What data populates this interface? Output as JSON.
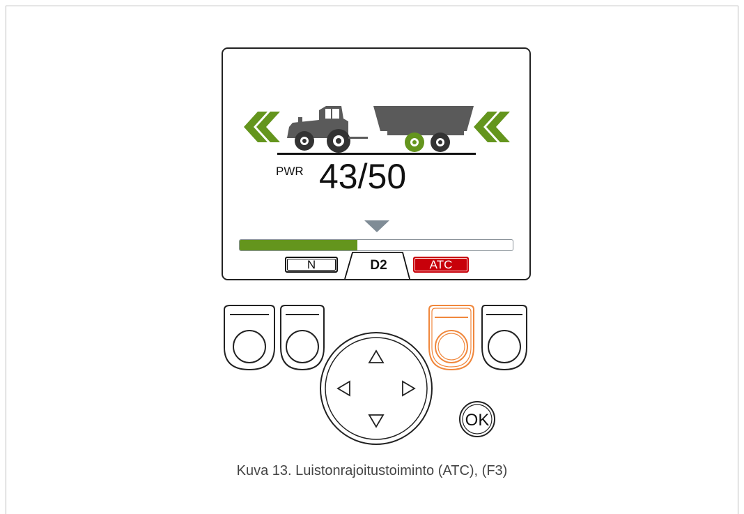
{
  "display": {
    "pwr_label": "PWR",
    "pwr_value": "43/50",
    "power_fraction": 0.43,
    "tabs": {
      "n": "N",
      "d2": "D2",
      "atc": "ATC"
    }
  },
  "controls": {
    "ok_label": "OK"
  },
  "caption": "Kuva 13. Luistonrajoitustoiminto (ATC), (F3)",
  "colors": {
    "accent_green": "#64951d",
    "atc_red": "#c8000a",
    "highlight_orange": "#f0873c",
    "vehicle_gray": "#5a5a5a"
  }
}
